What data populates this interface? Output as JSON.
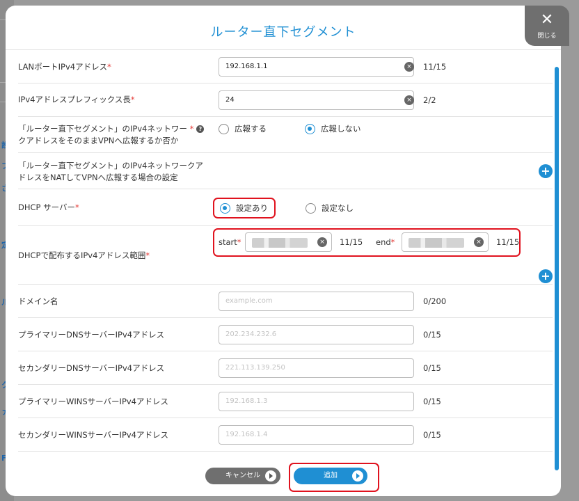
{
  "dialog": {
    "title": "ルーター直下セグメント",
    "close_label": "閉じる"
  },
  "fields": {
    "lan_port": {
      "label": "LANポートIPv4アドレス",
      "value": "192.168.1.1",
      "counter": "11/15"
    },
    "prefix": {
      "label": "IPv4アドレスプレフィックス長",
      "value": "24",
      "counter": "2/2"
    },
    "advertise": {
      "label_line1": "「ルーター直下セグメント」のIPv4ネットワー",
      "label_line2": "クアドレスをそのままVPNへ広報するか否か",
      "option_yes": "広報する",
      "option_no": "広報しない",
      "selected": "広報しない"
    },
    "nat": {
      "label_line1": "「ルーター直下セグメント」のIPv4ネットワークア",
      "label_line2": "ドレスをNATしてVPNへ広報する場合の設定"
    },
    "dhcp": {
      "label": "DHCP サーバー",
      "option_on": "設定あり",
      "option_off": "設定なし",
      "selected": "設定あり"
    },
    "dhcp_range": {
      "label": "DHCPで配布するIPv4アドレス範囲",
      "start_label": "start",
      "end_label": "end",
      "start_counter": "11/15",
      "end_counter": "11/15"
    },
    "domain": {
      "label": "ドメイン名",
      "placeholder": "example.com",
      "counter": "0/200"
    },
    "primary_dns": {
      "label": "プライマリーDNSサーバーIPv4アドレス",
      "placeholder": "202.234.232.6",
      "counter": "0/15"
    },
    "secondary_dns": {
      "label": "セカンダリーDNSサーバーIPv4アドレス",
      "placeholder": "221.113.139.250",
      "counter": "0/15"
    },
    "primary_wins": {
      "label": "プライマリーWINSサーバーIPv4アドレス",
      "placeholder": "192.168.1.3",
      "counter": "0/15"
    },
    "secondary_wins": {
      "label": "セカンダリーWINSサーバーIPv4アドレス",
      "placeholder": "192.168.1.4",
      "counter": "0/15"
    }
  },
  "actions": {
    "cancel": "キャンセル",
    "add": "追加"
  },
  "icons": {
    "clear": "×",
    "close": "✕",
    "plus": "+",
    "help": "?"
  },
  "colors": {
    "accent": "#1f8fd3",
    "required": "#e53935",
    "highlight": "#e0121e",
    "cancel_button": "#6f6f6f"
  }
}
